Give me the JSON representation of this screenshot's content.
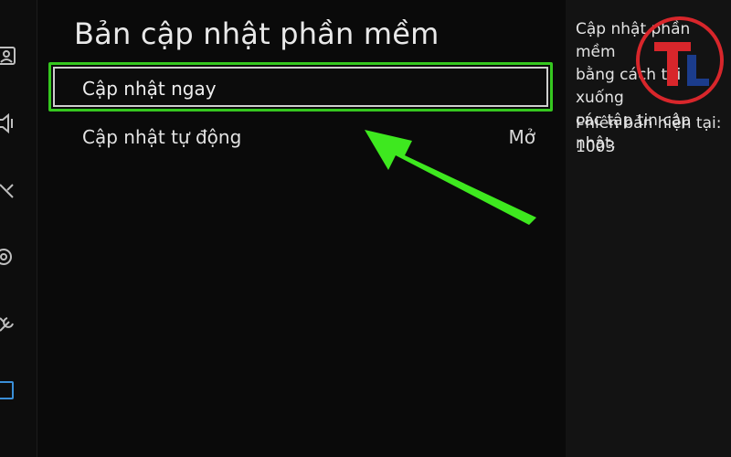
{
  "page": {
    "title": "Bản cập nhật phần mềm"
  },
  "menu": {
    "items": [
      {
        "label": "Cập nhật ngay",
        "value": "",
        "selected": true
      },
      {
        "label": "Cập nhật tự động",
        "value": "Mở",
        "selected": false
      }
    ]
  },
  "info": {
    "description": "Cập nhật phần mềm\nbằng cách tải xuống\ncác tập tin cập nhật.",
    "version_label": "Phiên bản hiện tại:",
    "version_value": "1003"
  },
  "sidebar": {
    "icons": [
      "picture-icon",
      "sound-icon",
      "broadcast-icon",
      "network-icon",
      "support-icon",
      "general-icon"
    ]
  },
  "watermark": {
    "text": "TL"
  },
  "colors": {
    "highlight": "#35c71f",
    "arrow": "#3ee81f",
    "logo_red": "#d8262b",
    "logo_blue": "#1b3c8c"
  }
}
